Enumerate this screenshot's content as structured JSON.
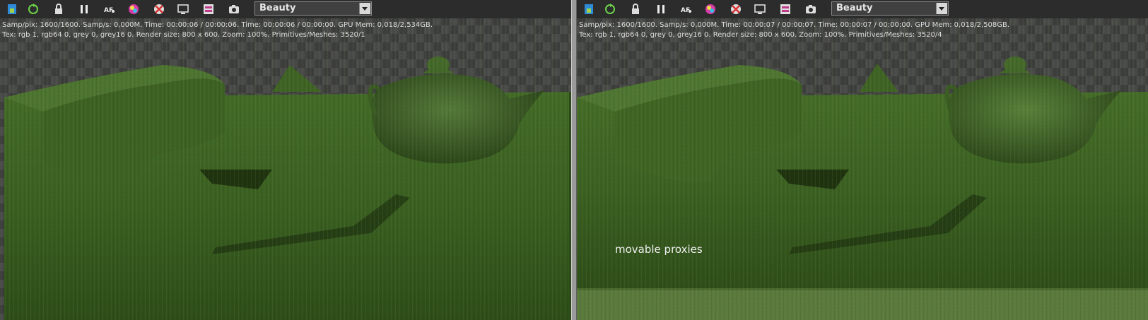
{
  "viewports": [
    {
      "toolbar": {
        "render_pass": "Beauty",
        "icons": [
          "save-image-icon",
          "restart-icon",
          "lock-icon",
          "pause-icon",
          "autofocus-icon",
          "color-picker-icon",
          "clear-icon",
          "display-icon",
          "settings-icon",
          "camera-icon"
        ]
      },
      "stats": {
        "line1": "Samp/pix: 1600/1600.   Samp/s: 0,000M.   Time: 00:00:06 / 00:00:06.   Time: 00:00:06 / 00:00:00.   GPU Mem: 0,018/2,534GB.",
        "line2": "Tex: rgb 1, rgb64 0, grey 0, grey16 0.   Render size: 800 x 600.   Zoom: 100%.   Primitives/Meshes: 3520/1"
      },
      "overlay_text": ""
    },
    {
      "toolbar": {
        "render_pass": "Beauty",
        "icons": [
          "save-image-icon",
          "restart-icon",
          "lock-icon",
          "pause-icon",
          "autofocus-icon",
          "color-picker-icon",
          "clear-icon",
          "display-icon",
          "settings-icon",
          "camera-icon"
        ]
      },
      "stats": {
        "line1": "Samp/pix: 1600/1600.   Samp/s: 0,000M.   Time: 00:00:07 / 00:00:07.   Time: 00:00:07 / 00:00:00.   GPU Mem: 0,018/2,508GB.",
        "line2": "Tex: rgb 1, rgb64 0, grey 0, grey16 0.   Render size: 800 x 600.   Zoom: 100%.   Primitives/Meshes: 3520/4"
      },
      "overlay_text": "movable proxies"
    }
  ],
  "colors": {
    "grass_dark": "#2c4a18",
    "grass_mid": "#3f6324",
    "grass_light": "#5a7f35",
    "toolbar_bg": "#2c2c2c",
    "stats_text": "#dcdcdc"
  }
}
